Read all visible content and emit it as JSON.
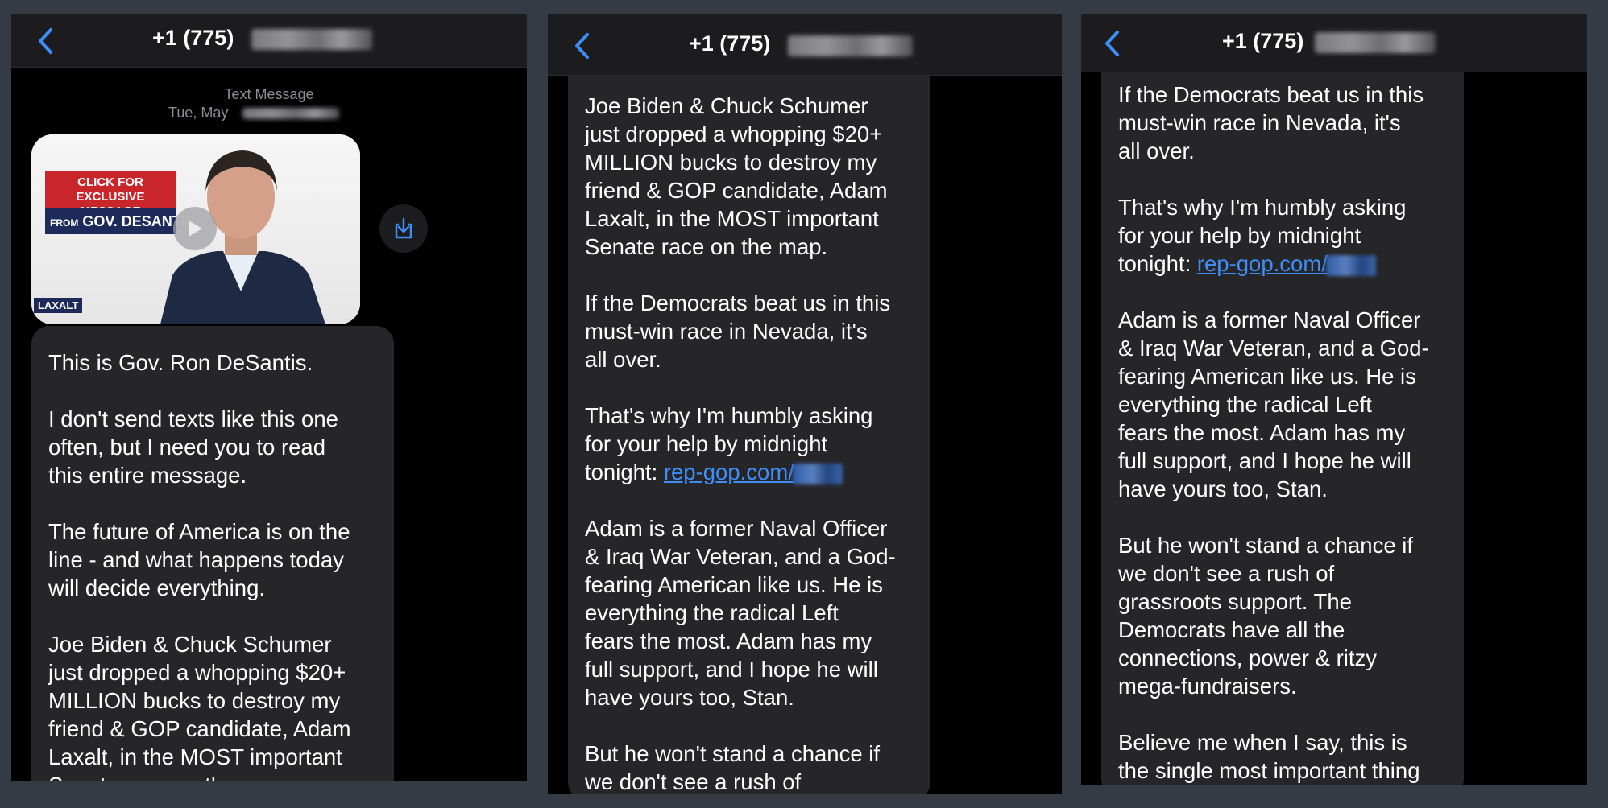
{
  "contact_number": "+1 (775)",
  "colors": {
    "accent": "#3e8ef7",
    "bubble": "#262628",
    "header": "#1c1c1e",
    "frame": "#353b45"
  },
  "icons": {
    "back": "chevron-left-icon",
    "play": "play-icon",
    "save": "download-icon"
  },
  "meta": {
    "type_label": "Text Message",
    "date_label": "Tue, May"
  },
  "video": {
    "badge_line1": "CLICK FOR",
    "badge_line2": "EXCLUSIVE MESSAGE",
    "badge_from": "FROM",
    "badge_name": "GOV. DESANTIS",
    "logo": "LAXALT"
  },
  "link_text": "rep-gop.com/",
  "panel1": {
    "paragraphs": [
      "This is Gov. Ron DeSantis.",
      "I don't send texts like this one\noften, but I need you to read\nthis entire message.",
      "The future of America is on the\nline - and what happens today\nwill decide everything.",
      "Joe Biden & Chuck Schumer\njust dropped a whopping $20+\nMILLION bucks to destroy my\nfriend & GOP candidate, Adam\nLaxalt, in the MOST important\nSenate race on the map."
    ]
  },
  "panel2": {
    "p1": "Joe Biden & Chuck Schumer\njust dropped a whopping $20+\nMILLION bucks to destroy my\nfriend & GOP candidate, Adam\nLaxalt, in the MOST important\nSenate race on the map.",
    "p2": "If the Democrats beat us in this\nmust-win race in Nevada, it's\nall over.",
    "p3": "That's why I'm humbly asking\nfor your help by midnight\ntonight: ",
    "p4": "Adam is a former Naval Officer\n& Iraq War Veteran, and a God-\nfearing American like us. He is\neverything the radical Left\nfears the most. Adam has my\nfull support, and I hope he will\nhave yours too, Stan.",
    "p5": "But he won't stand a chance if\nwe don't see a rush of\ngrassroots support. The"
  },
  "panel3": {
    "p1": "If the Democrats beat us in this\nmust-win race in Nevada, it's\nall over.",
    "p2": "That's why I'm humbly asking\nfor your help by midnight\ntonight: ",
    "p3": "Adam is a former Naval Officer\n& Iraq War Veteran, and a God-\nfearing American like us. He is\neverything the radical Left\nfears the most. Adam has my\nfull support, and I hope he will\nhave yours too, Stan.",
    "p4": "But he won't stand a chance if\nwe don't see a rush of\ngrassroots support. The\nDemocrats have all the\nconnections, power & ritzy\nmega-fundraisers.",
    "p5": "Believe me when I say, this is\nthe single most important thing"
  }
}
